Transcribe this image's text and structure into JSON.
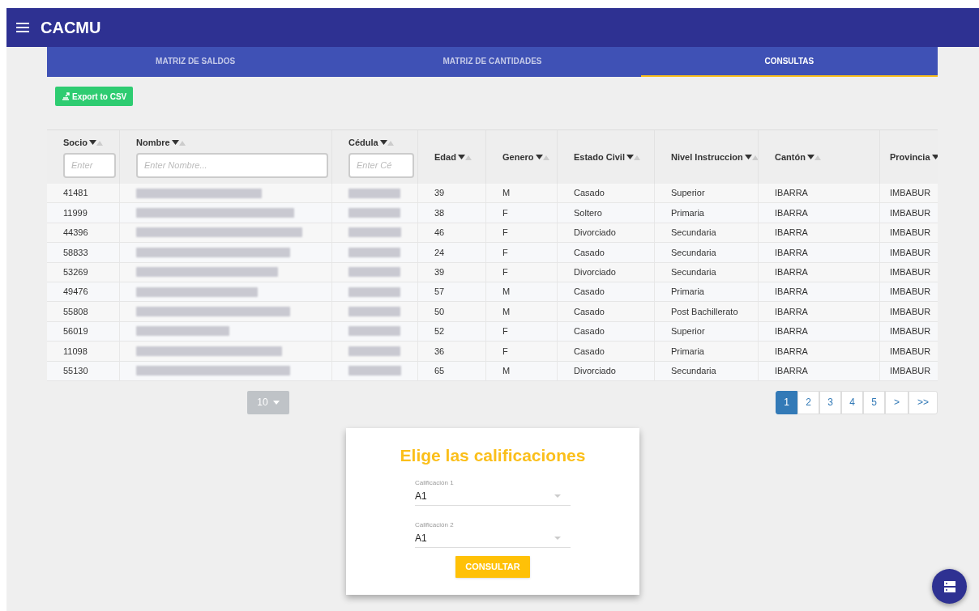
{
  "app_bar": {
    "title": "CACMU"
  },
  "tabs": [
    {
      "label": "MATRIZ DE SALDOS",
      "selected": false
    },
    {
      "label": "MATRIZ DE CANTIDADES",
      "selected": false
    },
    {
      "label": "CONSULTAS",
      "selected": true
    }
  ],
  "export_button": "Export to CSV",
  "table": {
    "columns": [
      {
        "label": "Socio",
        "filter_placeholder": "Enter"
      },
      {
        "label": "Nombre",
        "filter_placeholder": "Enter Nombre..."
      },
      {
        "label": "Cédula",
        "filter_placeholder": "Enter Cé"
      },
      {
        "label": "Edad"
      },
      {
        "label": "Genero"
      },
      {
        "label": "Estado Civil"
      },
      {
        "label": "Nivel Instruccion"
      },
      {
        "label": "Cantón"
      },
      {
        "label": "Provincia"
      }
    ],
    "rows": [
      [
        "41481",
        "",
        "",
        "39",
        "M",
        "Casado",
        "Superior",
        "IBARRA",
        "IMBABUR"
      ],
      [
        "11999",
        "",
        "",
        "38",
        "F",
        "Soltero",
        "Primaria",
        "IBARRA",
        "IMBABUR"
      ],
      [
        "44396",
        "",
        "",
        "46",
        "F",
        "Divorciado",
        "Secundaria",
        "IBARRA",
        "IMBABUR"
      ],
      [
        "58833",
        "",
        "",
        "24",
        "F",
        "Casado",
        "Secundaria",
        "IBARRA",
        "IMBABUR"
      ],
      [
        "53269",
        "",
        "",
        "39",
        "F",
        "Divorciado",
        "Secundaria",
        "IBARRA",
        "IMBABUR"
      ],
      [
        "49476",
        "",
        "",
        "57",
        "M",
        "Casado",
        "Primaria",
        "IBARRA",
        "IMBABUR"
      ],
      [
        "55808",
        "",
        "",
        "50",
        "M",
        "Casado",
        "Post Bachillerato",
        "IBARRA",
        "IMBABUR"
      ],
      [
        "56019",
        "",
        "",
        "52",
        "F",
        "Casado",
        "Superior",
        "IBARRA",
        "IMBABUR"
      ],
      [
        "11098",
        "",
        "",
        "36",
        "F",
        "Casado",
        "Primaria",
        "IBARRA",
        "IMBABUR"
      ],
      [
        "55130",
        "",
        "",
        "65",
        "M",
        "Divorciado",
        "Secundaria",
        "IBARRA",
        "IMBABUR"
      ]
    ]
  },
  "page_size": "10",
  "pagination": [
    {
      "label": "1",
      "selected": true
    },
    {
      "label": "2",
      "selected": false
    },
    {
      "label": "3",
      "selected": false
    },
    {
      "label": "4",
      "selected": false
    },
    {
      "label": "5",
      "selected": false
    },
    {
      "label": ">",
      "selected": false
    },
    {
      "label": ">>",
      "selected": false
    }
  ],
  "card": {
    "title": "Elige las calificaciones",
    "selects": [
      {
        "label": "Calificación 1",
        "value": "A1"
      },
      {
        "label": "Calificación 2",
        "value": "A1"
      }
    ],
    "button": "CONSULTAR"
  }
}
